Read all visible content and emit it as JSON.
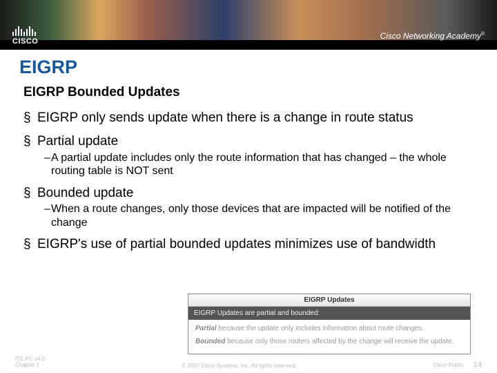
{
  "header": {
    "logo_text": "CISCO",
    "academy_text": "Cisco Networking Academy"
  },
  "slide": {
    "title": "EIGRP",
    "subtitle": "EIGRP Bounded Updates",
    "bullets": [
      {
        "text": "EIGRP only sends update when there is a change in route status",
        "subs": []
      },
      {
        "text": "Partial update",
        "subs": [
          "A partial update includes only the route information that has changed – the whole routing table is NOT sent"
        ]
      },
      {
        "text": "Bounded update",
        "subs": [
          "When a route changes, only those devices that are impacted will be notified of the change"
        ]
      },
      {
        "text": "EIGRP's use of partial bounded updates minimizes use of bandwidth",
        "subs": []
      }
    ]
  },
  "embed": {
    "titlebar": "EIGRP Updates",
    "header": "EIGRP Updates are partial and bounded:",
    "p1_label": "Partial",
    "p1_text": " because the update only includes information about route changes.",
    "p2_label": "Bounded",
    "p2_text": " because only those routers affected by the change will receive the update."
  },
  "footer": {
    "left_line1": "ITE PC v4.0",
    "left_line2": "Chapter 1",
    "center": "© 2007 Cisco Systems, Inc. All rights reserved.",
    "right_label": "Cisco Public",
    "page": "14"
  }
}
